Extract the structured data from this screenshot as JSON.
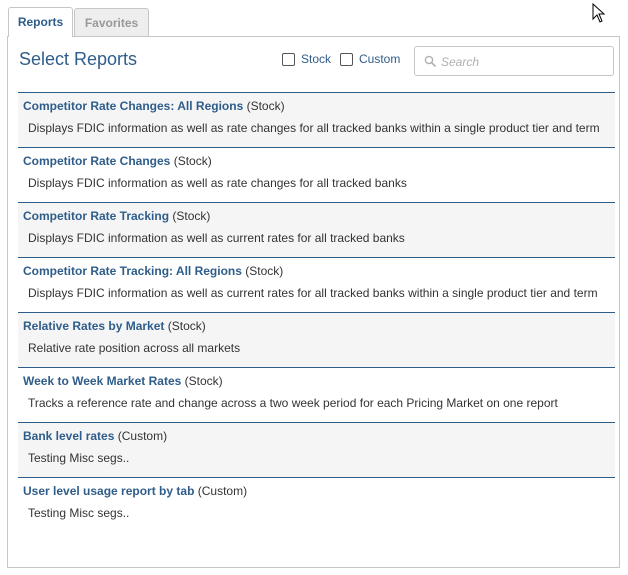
{
  "tabs": [
    {
      "label": "Reports",
      "active": true
    },
    {
      "label": "Favorites",
      "active": false
    }
  ],
  "header": {
    "title": "Select Reports"
  },
  "filters": {
    "stock_label": "Stock",
    "custom_label": "Custom"
  },
  "search": {
    "placeholder": "Search",
    "value": ""
  },
  "reports": [
    {
      "name": "Competitor Rate Changes: All Regions",
      "type": "(Stock)",
      "description": "Displays FDIC information as well as rate changes for all tracked banks within a single product tier and term"
    },
    {
      "name": "Competitor Rate Changes",
      "type": "(Stock)",
      "description": "Displays FDIC information as well as rate changes for all tracked banks"
    },
    {
      "name": "Competitor Rate Tracking",
      "type": "(Stock)",
      "description": "Displays FDIC information as well as current rates for all tracked banks"
    },
    {
      "name": "Competitor Rate Tracking: All Regions",
      "type": "(Stock)",
      "description": "Displays FDIC information as well as current rates for all tracked banks within a single product tier and term"
    },
    {
      "name": "Relative Rates by Market",
      "type": "(Stock)",
      "description": "Relative rate position across all markets"
    },
    {
      "name": "Week to Week Market Rates",
      "type": "(Stock)",
      "description": "Tracks a reference rate and change across a two week period for each Pricing Market on one report"
    },
    {
      "name": "Bank level rates",
      "type": "(Custom)",
      "description": "Testing Misc segs.."
    },
    {
      "name": "User level usage report by tab",
      "type": "(Custom)",
      "description": "Testing Misc segs.."
    }
  ],
  "colors": {
    "accent": "#2f5d8a",
    "row_alt": "#f5f5f5",
    "border": "#c6c6c6"
  },
  "icons": {
    "search": "search-icon",
    "cursor": "mouse-cursor-icon"
  }
}
